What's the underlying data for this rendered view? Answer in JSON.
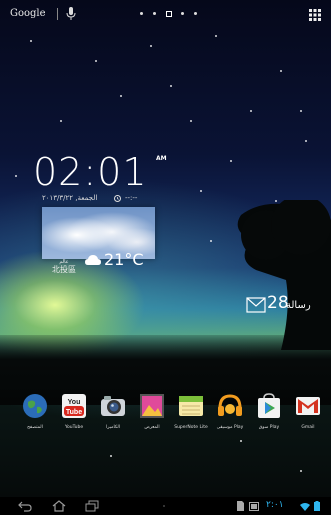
{
  "top_bar": {
    "search_label": "Google",
    "page_indicator": {
      "count": 5,
      "current_index": 2
    }
  },
  "clock_widget": {
    "time": "02:01",
    "ampm": "AM",
    "date": "الجمعة, ٢٠١٣/٣/٢٢",
    "next_alarm": "--:--"
  },
  "weather_widget": {
    "city": "北投區",
    "city_sub": "عالم",
    "temperature": "21°C",
    "condition_icon": "cloud-icon"
  },
  "messages_widget": {
    "count": "28",
    "label": "رسالة",
    "icon": "envelope-icon"
  },
  "dock": {
    "apps": [
      {
        "label": "المتصفح",
        "icon": "browser-globe-icon"
      },
      {
        "label": "YouTube",
        "icon": "youtube-icon"
      },
      {
        "label": "الكاميرا",
        "icon": "camera-icon"
      },
      {
        "label": "المعرض",
        "icon": "gallery-icon"
      },
      {
        "label": "SuperNote Lite",
        "icon": "supernote-icon"
      },
      {
        "label": "موسيقى Play",
        "icon": "play-music-icon"
      },
      {
        "label": "سوق Play",
        "icon": "play-store-icon"
      },
      {
        "label": "Gmail",
        "icon": "gmail-icon"
      }
    ]
  },
  "nav_bar": {
    "status_time": "٢:٠١",
    "accent_color": "#2fb6ef"
  }
}
